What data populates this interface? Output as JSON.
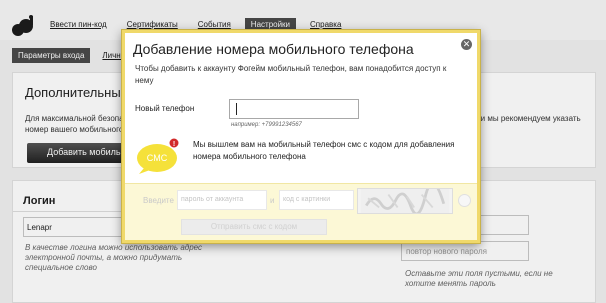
{
  "nav": {
    "items": [
      "Ввести пин-код",
      "Сертификаты",
      "События",
      "Настройки",
      "Справка"
    ],
    "active_index": 3
  },
  "subnav": {
    "items": [
      "Параметры входа",
      "Личные"
    ],
    "active_index": 0
  },
  "panel1": {
    "title": "Дополнительные м",
    "text_left": "Для максимальной безопа\nномер вашего мобильного т",
    "text_right": "сти мы рекомендуем указать",
    "add_button": "Добавить мобиль"
  },
  "panel2": {
    "title": "Логин",
    "login_value": "Lenapr",
    "login_hint": "В качестве логина можно использовать адрес электронной почты, а можно придумать специальное слово",
    "repeat_password_placeholder": "повтор нового пароля",
    "password_hint": "Оставьте эти поля пустыми, если не хотите менять пароль"
  },
  "modal": {
    "title": "Добавление номера мобильного телефона",
    "description": "Чтобы добавить к аккаунту Фогейм мобильный телефон, вам понадобится доступ к нему",
    "phone_label": "Новый телефон",
    "phone_value": "",
    "phone_example": "например: +79991234567",
    "sms_icon_text": "СМС",
    "sms_badge": "!",
    "sms_message": "Мы вышлем вам на мобильный телефон смс с кодом для добавления номера мобильного телефона",
    "code_label": "Введите",
    "password_placeholder": "пароль от аккаунта",
    "and_label": "и",
    "captcha_placeholder": "код с картинки",
    "send_button": "Отправить смс с кодом",
    "close_symbol": "✕"
  },
  "colors": {
    "modal_border": "#f0d96a",
    "sms_bubble": "#f5e13a",
    "badge": "#d12a2a",
    "nav_active": "#4a4a4a"
  }
}
